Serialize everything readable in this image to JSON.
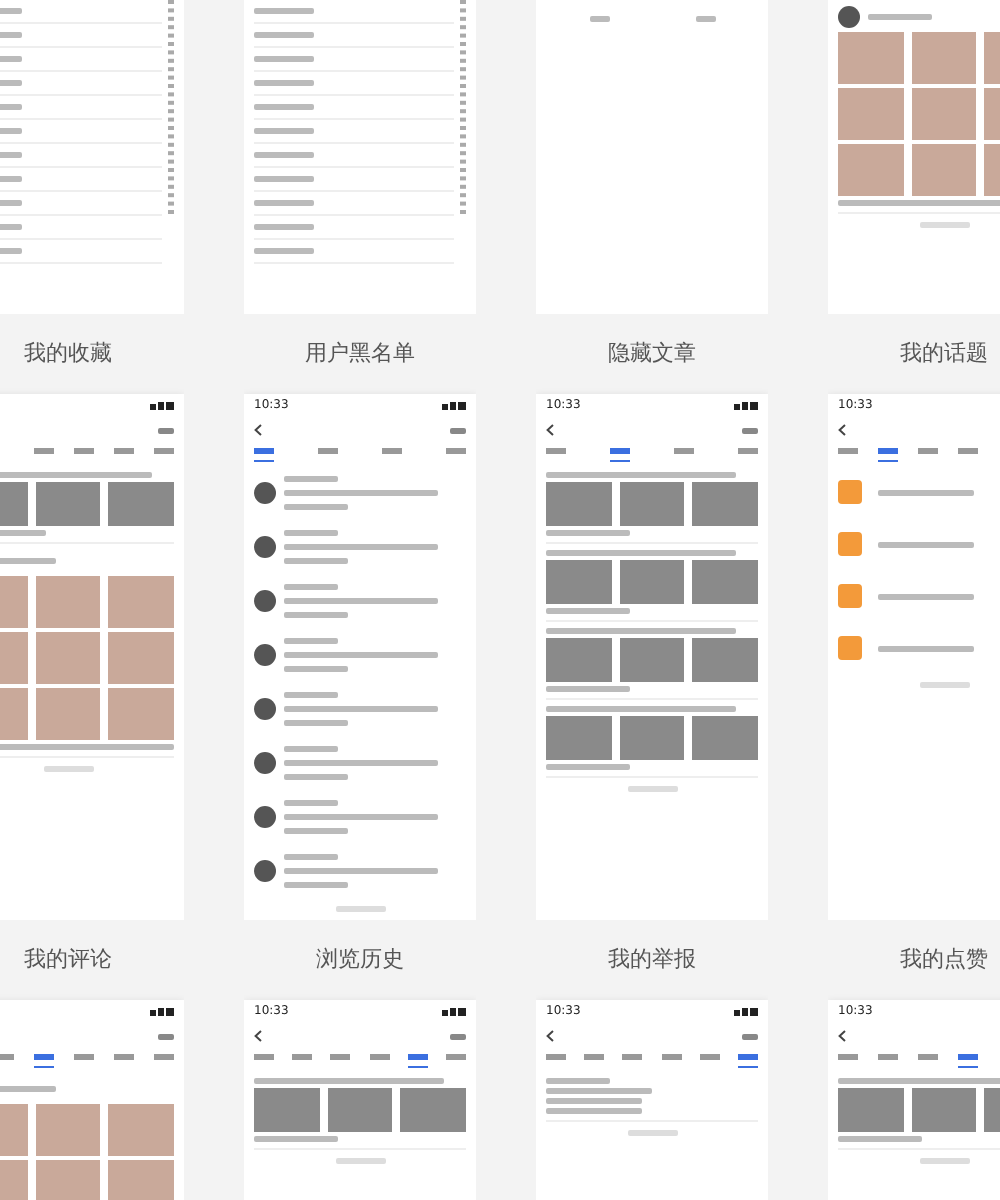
{
  "screens": [
    {
      "kind": "contacts",
      "items": [
        {
          "kind": "row"
        },
        {
          "kind": "row"
        },
        {
          "kind": "row"
        },
        {
          "kind": "row"
        },
        {
          "kind": "row"
        },
        {
          "kind": "row"
        },
        {
          "kind": "row"
        },
        {
          "kind": "row"
        },
        {
          "kind": "row"
        },
        {
          "kind": "row"
        },
        {
          "kind": "row"
        }
      ]
    },
    {
      "kind": "contacts",
      "items": [
        {
          "kind": "row"
        },
        {
          "kind": "row"
        },
        {
          "kind": "row"
        },
        {
          "kind": "row"
        },
        {
          "kind": "row"
        },
        {
          "kind": "row"
        },
        {
          "kind": "row"
        },
        {
          "kind": "row"
        },
        {
          "kind": "row"
        },
        {
          "kind": "row"
        },
        {
          "kind": "row"
        }
      ]
    },
    {
      "kind": "blank"
    },
    {
      "kind": "feed",
      "items": [
        {
          "kind": "photo-post"
        }
      ]
    },
    {
      "kind": "feed",
      "title": "我的收藏",
      "tabs": [
        {
          "selected": false
        },
        {
          "selected": false
        },
        {
          "selected": false
        },
        {
          "selected": false
        }
      ],
      "items": [
        {
          "kind": "news"
        },
        {
          "kind": "photo-post"
        }
      ]
    },
    {
      "kind": "feed",
      "title": "用户黑名单",
      "time": "10:33",
      "tabs": [
        {
          "selected": true
        },
        {
          "selected": false
        },
        {
          "selected": false
        },
        {
          "selected": false
        }
      ],
      "items": [
        {
          "kind": "user"
        },
        {
          "kind": "user"
        },
        {
          "kind": "user"
        },
        {
          "kind": "user"
        },
        {
          "kind": "user"
        },
        {
          "kind": "user"
        },
        {
          "kind": "user"
        },
        {
          "kind": "user"
        }
      ]
    },
    {
      "kind": "feed",
      "title": "隐藏文章",
      "time": "10:33",
      "tabs": [
        {
          "selected": false
        },
        {
          "selected": true
        },
        {
          "selected": false
        },
        {
          "selected": false
        }
      ],
      "items": [
        {
          "kind": "news"
        },
        {
          "kind": "news"
        },
        {
          "kind": "news"
        },
        {
          "kind": "news"
        }
      ]
    },
    {
      "kind": "feed",
      "title": "我的话题",
      "time": "10:33",
      "tabs": [
        {
          "selected": false
        },
        {
          "selected": true
        },
        {
          "selected": false
        },
        {
          "selected": false
        }
      ],
      "items": [
        {
          "kind": "topic"
        },
        {
          "kind": "topic"
        },
        {
          "kind": "topic"
        },
        {
          "kind": "topic"
        }
      ]
    },
    {
      "kind": "feed",
      "title": "我的评论",
      "tabs": [
        {
          "selected": false
        },
        {
          "selected": true
        },
        {
          "selected": false
        },
        {
          "selected": false
        },
        {
          "selected": false
        }
      ],
      "items": [
        {
          "kind": "photo-post"
        }
      ]
    },
    {
      "kind": "feed",
      "title": "浏览历史",
      "time": "10:33",
      "tabs": [
        {
          "selected": false
        },
        {
          "selected": false
        },
        {
          "selected": false
        },
        {
          "selected": false
        },
        {
          "selected": true
        },
        {
          "selected": false
        }
      ],
      "items": [
        {
          "kind": "news"
        }
      ]
    },
    {
      "kind": "feed",
      "title": "我的举报",
      "time": "10:33",
      "tabs": [
        {
          "selected": false
        },
        {
          "selected": false
        },
        {
          "selected": false
        },
        {
          "selected": false
        },
        {
          "selected": false
        },
        {
          "selected": true
        }
      ],
      "items": [
        {
          "kind": "report"
        }
      ]
    },
    {
      "kind": "feed",
      "title": "我的点赞",
      "time": "10:33",
      "tabs": [
        {
          "selected": false
        },
        {
          "selected": false
        },
        {
          "selected": false
        },
        {
          "selected": true
        }
      ],
      "items": [
        {
          "kind": "news"
        }
      ]
    }
  ]
}
